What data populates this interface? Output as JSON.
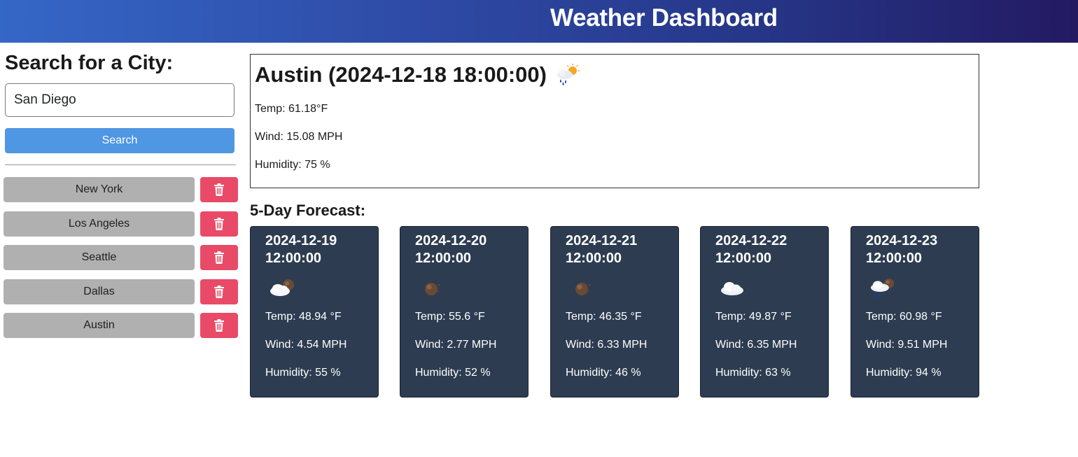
{
  "header": {
    "title": "Weather Dashboard"
  },
  "search": {
    "heading": "Search for a City:",
    "input_value": "San Diego",
    "button_label": "Search"
  },
  "history": [
    {
      "city": "New York"
    },
    {
      "city": "Los Angeles"
    },
    {
      "city": "Seattle"
    },
    {
      "city": "Dallas"
    },
    {
      "city": "Austin"
    }
  ],
  "current": {
    "title": "Austin (2024-12-18 18:00:00)",
    "icon": "rain-sun-icon",
    "temp": "Temp: 61.18°F",
    "wind": "Wind: 15.08 MPH",
    "humidity": "Humidity: 75 %"
  },
  "forecast": {
    "heading": "5-Day Forecast:",
    "days": [
      {
        "date": "2024-12-19 12:00:00",
        "icon": "cloudy-night-icon",
        "temp": "Temp: 48.94 °F",
        "wind": "Wind: 4.54 MPH",
        "humidity": "Humidity: 55 %"
      },
      {
        "date": "2024-12-20 12:00:00",
        "icon": "clear-night-icon",
        "temp": "Temp: 55.6 °F",
        "wind": "Wind: 2.77 MPH",
        "humidity": "Humidity: 52 %"
      },
      {
        "date": "2024-12-21 12:00:00",
        "icon": "clear-night-icon",
        "temp": "Temp: 46.35 °F",
        "wind": "Wind: 6.33 MPH",
        "humidity": "Humidity: 46 %"
      },
      {
        "date": "2024-12-22 12:00:00",
        "icon": "cloud-icon",
        "temp": "Temp: 49.87 °F",
        "wind": "Wind: 6.35 MPH",
        "humidity": "Humidity: 63 %"
      },
      {
        "date": "2024-12-23 12:00:00",
        "icon": "rain-night-icon",
        "temp": "Temp: 60.98 °F",
        "wind": "Wind: 9.51 MPH",
        "humidity": "Humidity: 94 %"
      }
    ]
  },
  "colors": {
    "header_start": "#3567c7",
    "header_end": "#231a62",
    "search_button": "#4f96e3",
    "history_button": "#b0b0b0",
    "delete_button": "#e84a67",
    "forecast_card": "#2d3c50"
  }
}
